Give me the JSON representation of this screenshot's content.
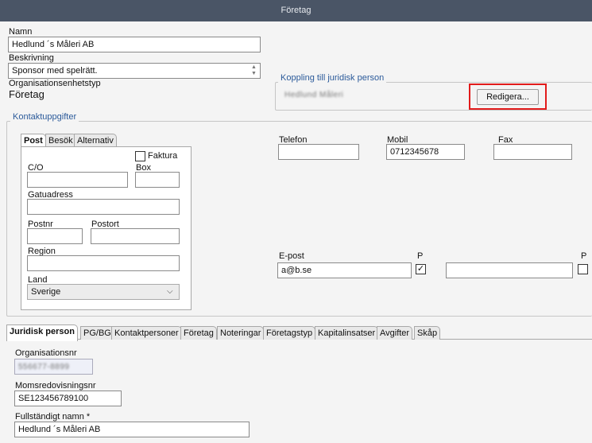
{
  "window": {
    "title": "Företag"
  },
  "top": {
    "name_label": "Namn",
    "name_value": "Hedlund ´s Måleri AB",
    "desc_label": "Beskrivning",
    "desc_value": "Sponsor med spelrätt.",
    "orgtype_label": "Organisationsenhetstyp",
    "orgtype_value": "Företag"
  },
  "legal": {
    "title": "Koppling till juridisk person",
    "linked_name": "Hedlund Måleri",
    "edit_button": "Redigera..."
  },
  "contact": {
    "title": "Kontaktuppgifter",
    "tabs": [
      "Post",
      "Besök",
      "Alternativ"
    ],
    "faktura_label": "Faktura",
    "co_label": "C/O",
    "box_label": "Box",
    "street_label": "Gatuadress",
    "postnr_label": "Postnr",
    "postort_label": "Postort",
    "region_label": "Region",
    "country_label": "Land",
    "country_value": "Sverige",
    "phone_label": "Telefon",
    "mobile_label": "Mobil",
    "mobile_value": "0712345678",
    "fax_label": "Fax",
    "email_label": "E-post",
    "email_value": "a@b.se",
    "p_label": "P"
  },
  "bottom_tabs": [
    "Juridisk person",
    "PG/BG",
    "Kontaktpersoner",
    "Företag",
    "Noteringar",
    "Företagstyp",
    "Kapitalinsatser",
    "Avgifter",
    "Skåp"
  ],
  "juridisk": {
    "orgnr_label": "Organisationsnr",
    "orgnr_value": "556677-8899",
    "vat_label": "Momsredovisningsnr",
    "vat_value": "SE123456789100",
    "fullname_label": "Fullständigt namn *",
    "fullname_value": "Hedlund ´s Måleri AB"
  }
}
